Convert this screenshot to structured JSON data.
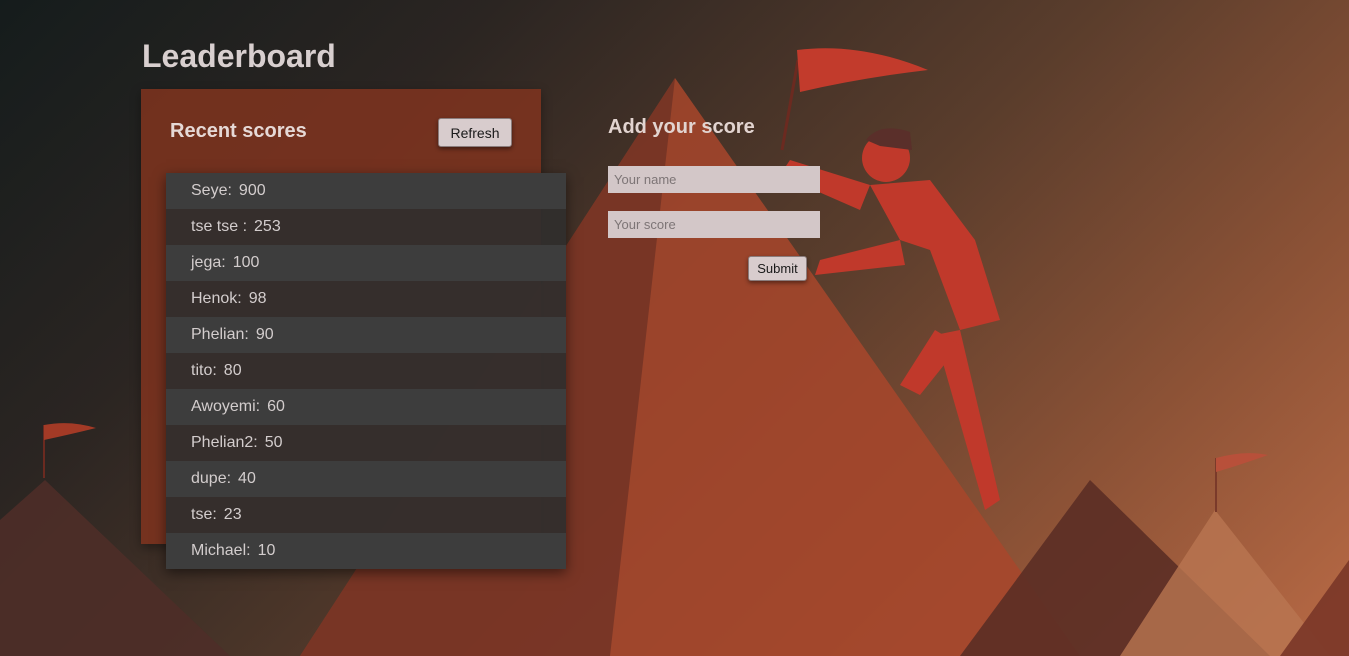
{
  "page": {
    "title": "Leaderboard"
  },
  "recent": {
    "title": "Recent scores",
    "refresh_label": "Refresh",
    "scores": [
      {
        "name": "Seye",
        "score": "900"
      },
      {
        "name": "tse tse ",
        "score": "253"
      },
      {
        "name": "jega",
        "score": "100"
      },
      {
        "name": "Henok",
        "score": "98"
      },
      {
        "name": "Phelian",
        "score": "90"
      },
      {
        "name": "tito",
        "score": "80"
      },
      {
        "name": "Awoyemi",
        "score": "60"
      },
      {
        "name": "Phelian2",
        "score": "50"
      },
      {
        "name": "dupe",
        "score": "40"
      },
      {
        "name": "tse",
        "score": "23"
      },
      {
        "name": "Michael",
        "score": "10"
      }
    ]
  },
  "add": {
    "title": "Add your score",
    "name_placeholder": "Your name",
    "name_value": "",
    "score_placeholder": "Your score",
    "score_value": "",
    "submit_label": "Submit"
  },
  "background": {
    "illustration": "mountain-climber-with-flag-illustration"
  },
  "colors": {
    "panel": "#80341e",
    "list_row_dark": "#3d3d3d",
    "button": "#d8cccd",
    "climber": "#c0392b"
  }
}
